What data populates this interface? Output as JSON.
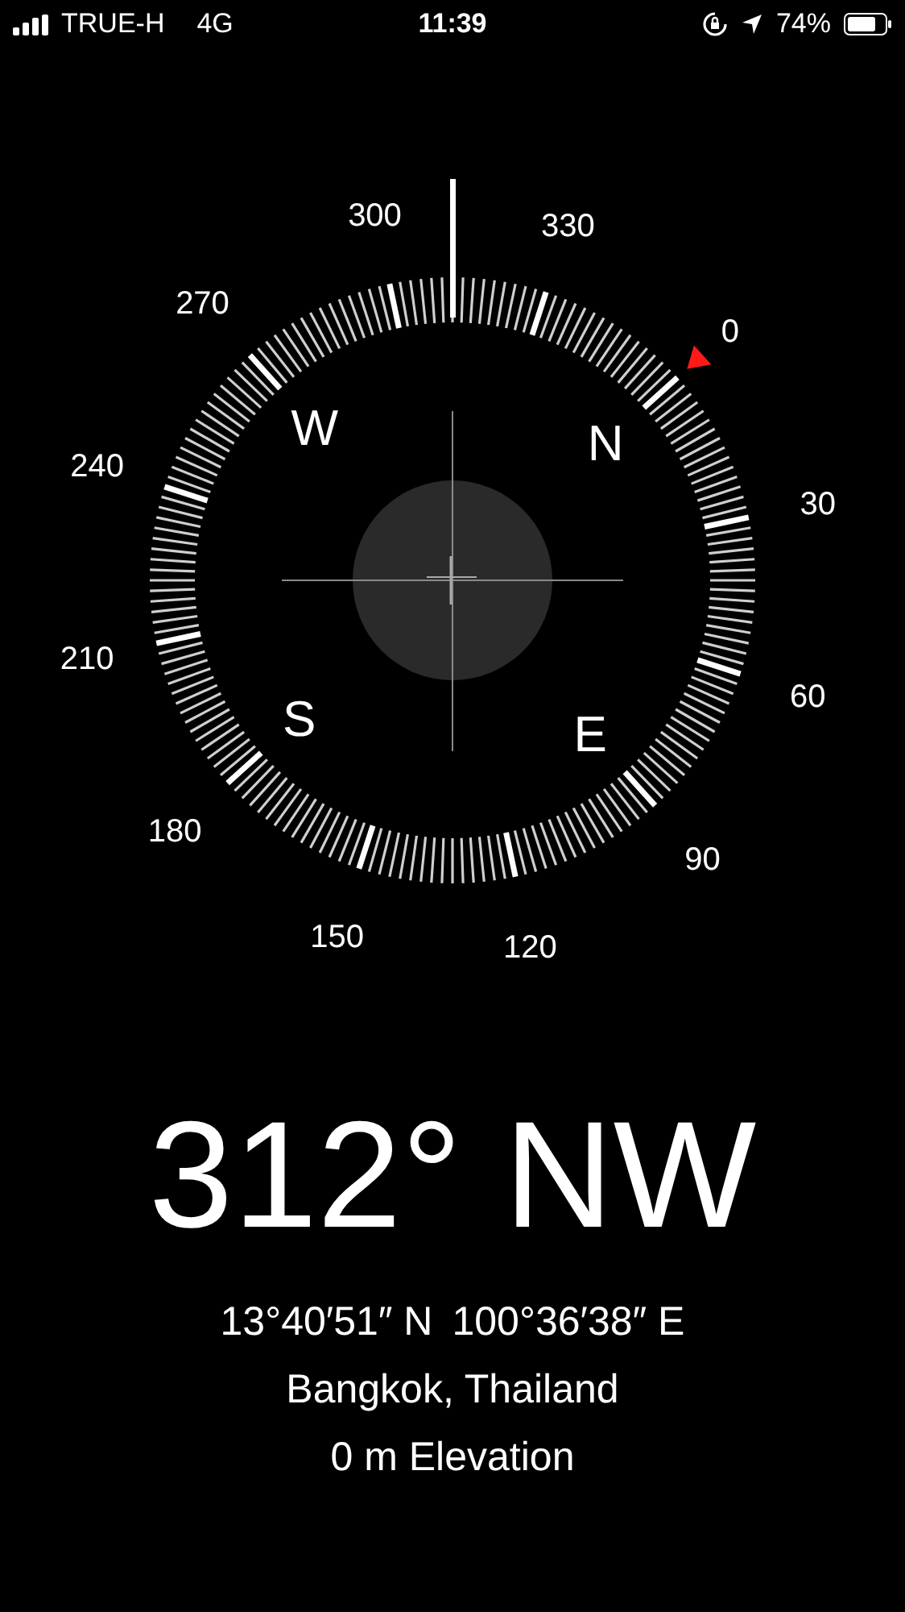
{
  "status_bar": {
    "carrier": "TRUE-H",
    "network": "4G",
    "time": "11:39",
    "battery": "74%"
  },
  "compass": {
    "degree_labels": [
      "0",
      "30",
      "60",
      "90",
      "120",
      "150",
      "180",
      "210",
      "240",
      "270",
      "300",
      "330"
    ],
    "cardinals": [
      "W",
      "N",
      "S",
      "E"
    ]
  },
  "heading": "312° NW",
  "latitude": "13°40′51″ N",
  "longitude": "100°36′38″ E",
  "place": "Bangkok, Thailand",
  "elevation": "0 m Elevation"
}
